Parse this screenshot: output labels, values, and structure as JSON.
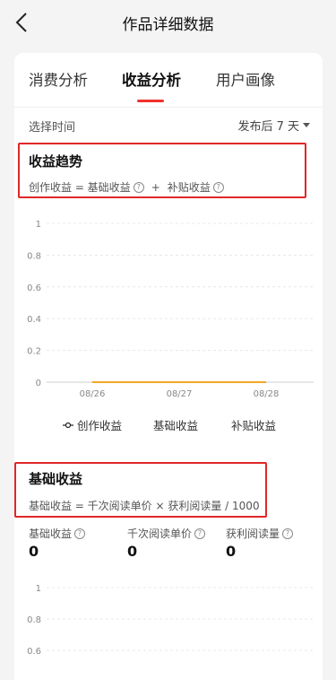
{
  "nav": {
    "title": "作品详细数据"
  },
  "tabs": [
    {
      "label": "消费分析",
      "active": false
    },
    {
      "label": "收益分析",
      "active": true
    },
    {
      "label": "用户画像",
      "active": false
    }
  ],
  "time_filter": {
    "label": "选择时间",
    "value": "发布后 7 天"
  },
  "trend": {
    "title": "收益趋势",
    "formula": {
      "a": "创作收益 = 基础收益",
      "plus": "+",
      "b": "补贴收益"
    }
  },
  "legend": {
    "creation": "创作收益",
    "base": "基础收益",
    "subsidy": "补贴收益"
  },
  "chart_data": {
    "type": "line",
    "x": [
      "08/26",
      "08/27",
      "08/28"
    ],
    "series": [
      {
        "name": "创作收益",
        "values": [
          0,
          0,
          0
        ]
      }
    ],
    "y_ticks": [
      "1",
      "0.8",
      "0.6",
      "0.4",
      "0.2",
      "0"
    ],
    "ylim": [
      0,
      1
    ],
    "grid": true,
    "legend_position": "bottom",
    "line_color": "#f5a623"
  },
  "base": {
    "title": "基础收益",
    "formula": "基础收益 = 千次阅读单价 × 获利阅读量 / 1000",
    "metrics": [
      {
        "label": "基础收益",
        "value": "0"
      },
      {
        "label": "千次阅读单价",
        "value": "0"
      },
      {
        "label": "获利阅读量",
        "value": "0"
      }
    ],
    "y_ticks": [
      "1",
      "0.8",
      "0.6"
    ]
  }
}
